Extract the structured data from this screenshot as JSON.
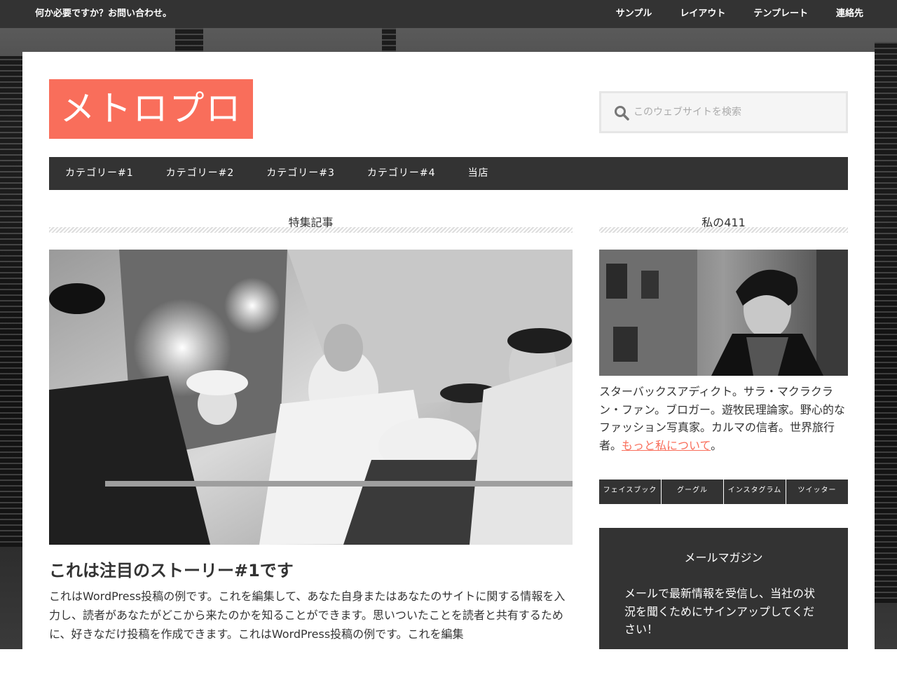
{
  "topbar": {
    "tagline": "何か必要ですか？お問い合わせ。",
    "links": [
      "サンプル",
      "レイアウト",
      "テンプレート",
      "連絡先"
    ]
  },
  "site": {
    "title": "メトロプロ",
    "accent_color": "#f96e5b"
  },
  "search": {
    "placeholder": "このウェブサイトを検索",
    "icon": "search-icon"
  },
  "nav": {
    "items": [
      "カテゴリー#1",
      "カテゴリー#2",
      "カテゴリー#3",
      "カテゴリー#4",
      "当店"
    ]
  },
  "main": {
    "section_title": "特集記事",
    "post_title": "これは注目のストーリー#1です",
    "post_excerpt": "これはWordPress投稿の例です。これを編集して、あなた自身またはあなたのサイトに関する情報を入力し、読者があなたがどこから来たのかを知ることができます。思いついたことを読者と共有するために、好きなだけ投稿を作成できます。これはWordPress投稿の例です。これを編集"
  },
  "sidebar": {
    "about_title": "私の411",
    "bio_text": "スターバックスアディクト。サラ・マクラクラン・ファン。ブロガー。遊牧民理論家。野心的なファッション写真家。カルマの信者。世界旅行者。",
    "bio_link": "もっと私について",
    "bio_end": "。",
    "social": [
      "フェイスブック",
      "グーグル",
      "インスタグラム",
      "ツイッター"
    ],
    "newsletter_title": "メールマガジン",
    "newsletter_text": "メールで最新情報を受信し、当社の状況を聞くためにサインアップしてください！"
  }
}
